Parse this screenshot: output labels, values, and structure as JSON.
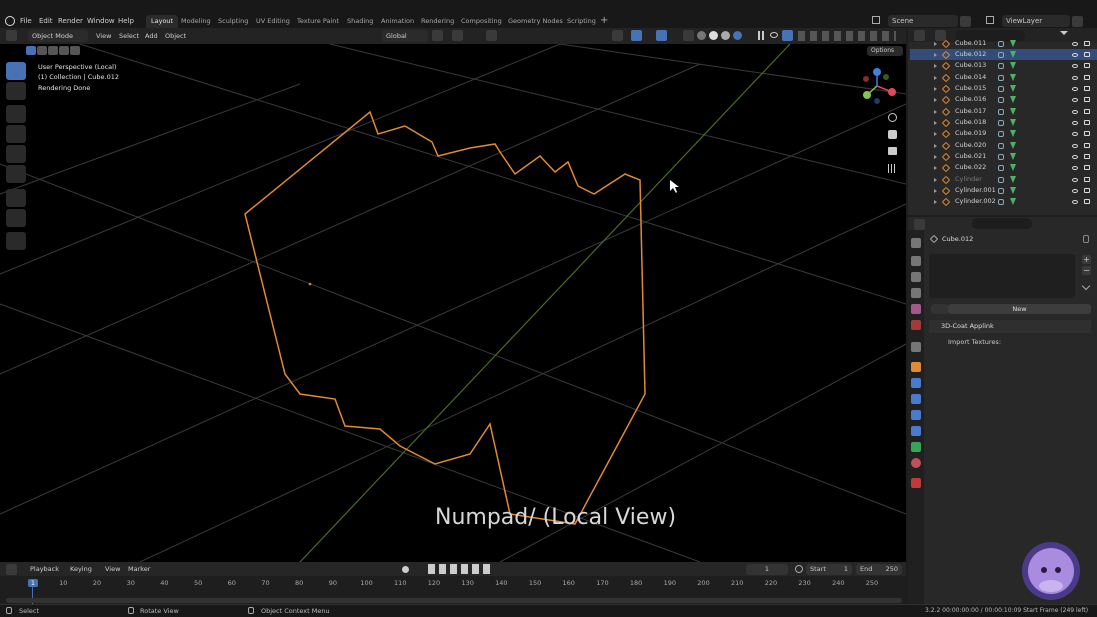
{
  "top_menu": {
    "file": "File",
    "edit": "Edit",
    "render": "Render",
    "window": "Window",
    "help": "Help"
  },
  "workspaces": [
    "Layout",
    "Modeling",
    "Sculpting",
    "UV Editing",
    "Texture Paint",
    "Shading",
    "Animation",
    "Rendering",
    "Compositing",
    "Geometry Nodes",
    "Scripting"
  ],
  "scene": {
    "name": "Scene",
    "view_layer": "ViewLayer"
  },
  "viewport_header": {
    "mode": "Object Mode",
    "view": "View",
    "select": "Select",
    "add": "Add",
    "object": "Object",
    "transform_orientation": "Global",
    "options": "Options"
  },
  "viewport_overlay": {
    "line1": "User Perspective (Local)",
    "line2": "(1) Collection | Cube.012",
    "line3": "Rendering Done"
  },
  "caption": "Numpad/ (Local View)",
  "outliner": {
    "items": [
      {
        "name": "Cube.011",
        "state": "partial"
      },
      {
        "name": "Cube.012",
        "state": "selected"
      },
      {
        "name": "Cube.013",
        "state": "normal"
      },
      {
        "name": "Cube.014",
        "state": "normal"
      },
      {
        "name": "Cube.015",
        "state": "normal"
      },
      {
        "name": "Cube.016",
        "state": "normal"
      },
      {
        "name": "Cube.017",
        "state": "normal"
      },
      {
        "name": "Cube.018",
        "state": "normal"
      },
      {
        "name": "Cube.019",
        "state": "normal"
      },
      {
        "name": "Cube.020",
        "state": "normal"
      },
      {
        "name": "Cube.021",
        "state": "normal"
      },
      {
        "name": "Cube.022",
        "state": "normal"
      },
      {
        "name": "Cylinder",
        "state": "dim"
      },
      {
        "name": "Cylinder.001",
        "state": "normal"
      },
      {
        "name": "Cylinder.002",
        "state": "normal"
      }
    ]
  },
  "properties": {
    "object_name": "Cube.012",
    "new_button": "New",
    "panel": "3D-Coat Applink",
    "subpanel": "Import Textures:"
  },
  "timeline": {
    "playback": "Playback",
    "keying": "Keying",
    "view": "View",
    "marker": "Marker",
    "current_frame": "1",
    "start_label": "Start",
    "start": "1",
    "end_label": "End",
    "end": "250",
    "ticks": [
      "1",
      "10",
      "20",
      "30",
      "40",
      "50",
      "60",
      "70",
      "80",
      "90",
      "100",
      "110",
      "120",
      "130",
      "140",
      "150",
      "160",
      "170",
      "180",
      "190",
      "200",
      "210",
      "220",
      "230",
      "240",
      "250"
    ]
  },
  "status": {
    "select": "Select",
    "rotate": "Rotate View",
    "context": "Object Context Menu",
    "info": "3.2.2 00:00:00:00 / 00:00:10:09 Start Frame (249 left)"
  },
  "colors": {
    "accent": "#4772b3",
    "selection_outline": "#e08a35",
    "x_axis": "#e04a5c",
    "y_axis": "#8bc34a",
    "z_axis": "#3f7fe0"
  }
}
